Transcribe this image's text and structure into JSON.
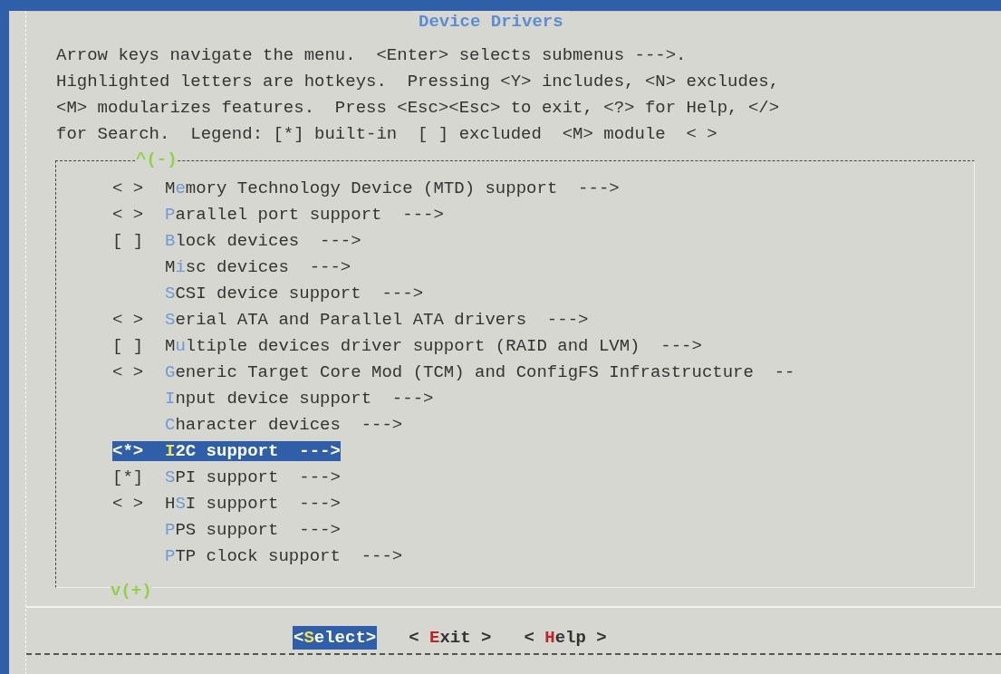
{
  "dialog": {
    "title": "Device Drivers",
    "help_lines": [
      "Arrow keys navigate the menu.  <Enter> selects submenus --->.",
      "Highlighted letters are hotkeys.  Pressing <Y> includes, <N> excludes,",
      "<M> modularizes features.  Press <Esc><Esc> to exit, <?> for Help, </>",
      "for Search.  Legend: [*] built-in  [ ] excluded  <M> module  < >"
    ],
    "scroll_up": "^(-)",
    "items": [
      {
        "prefix": "< >",
        "label": "M**e**mory Technology Device (MTD) support  --->",
        "selected": false
      },
      {
        "prefix": "< >",
        "label": "**P**arallel port support  --->",
        "selected": false
      },
      {
        "prefix": "[ ]",
        "label": "**B**lock devices  --->",
        "selected": false
      },
      {
        "label": "M**i**sc devices  --->",
        "selected": false
      },
      {
        "label": "**S**CSI device support  --->",
        "selected": false
      },
      {
        "prefix": "< >",
        "label": "**S**erial ATA and Parallel ATA drivers  --->",
        "selected": false
      },
      {
        "prefix": "[ ]",
        "label": "M**u**ltiple devices driver support (RAID and LVM)  --->",
        "selected": false
      },
      {
        "prefix": "< >",
        "label": "**G**eneric Target Core Mod (TCM) and ConfigFS Infrastructure  --",
        "selected": false
      },
      {
        "label": "**I**nput device support  --->",
        "selected": false
      },
      {
        "label": "**C**haracter devices  --->",
        "selected": false
      },
      {
        "prefix": "<*>",
        "label": "**I**2C support  --->",
        "selected": true
      },
      {
        "prefix": "[*]",
        "label": "**S**PI support  --->",
        "selected": false
      },
      {
        "prefix": "< >",
        "label": "H**S**I support  --->",
        "selected": false
      },
      {
        "label": "**P**PS support  --->",
        "selected": false
      },
      {
        "label": "**P**TP clock support  --->",
        "selected": false
      }
    ],
    "scroll_down": "v(+)",
    "buttons": [
      {
        "label": "<**S**elect>",
        "selected": true
      },
      {
        "label": "< **E**xit >",
        "selected": false
      },
      {
        "label": "< **H**elp >",
        "selected": false
      }
    ]
  }
}
